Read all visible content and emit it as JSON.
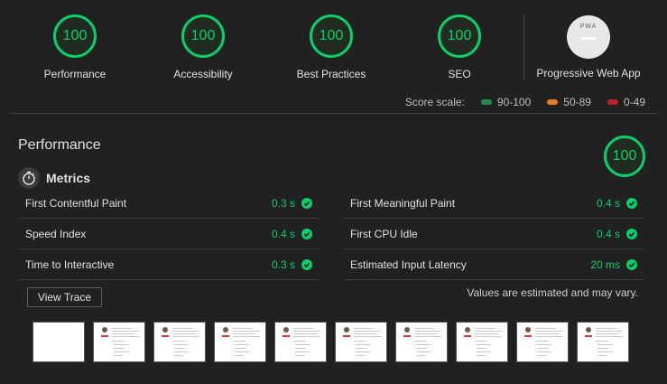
{
  "gauges": [
    {
      "score": "100",
      "label": "Performance"
    },
    {
      "score": "100",
      "label": "Accessibility"
    },
    {
      "score": "100",
      "label": "Best Practices"
    },
    {
      "score": "100",
      "label": "SEO"
    }
  ],
  "pwa": {
    "badge_text": "PWA",
    "label": "Progressive Web App"
  },
  "score_scale": {
    "label": "Score scale:",
    "items": [
      {
        "text": "90-100",
        "color": "#0cce6b"
      },
      {
        "text": "50-89",
        "color": "#ffa400"
      },
      {
        "text": "0-49",
        "color": "#ff4e42"
      }
    ]
  },
  "category": {
    "title": "Performance",
    "score": "100"
  },
  "metrics": {
    "heading": "Metrics",
    "left": [
      {
        "name": "First Contentful Paint",
        "value": "0.3 s"
      },
      {
        "name": "Speed Index",
        "value": "0.4 s"
      },
      {
        "name": "Time to Interactive",
        "value": "0.3 s"
      }
    ],
    "right": [
      {
        "name": "First Meaningful Paint",
        "value": "0.4 s"
      },
      {
        "name": "First CPU Idle",
        "value": "0.4 s"
      },
      {
        "name": "Estimated Input Latency",
        "value": "20 ms"
      }
    ]
  },
  "actions": {
    "view_trace": "View Trace"
  },
  "estimate_note": "Values are estimated and may vary.",
  "colors": {
    "pass": "#0cce6b",
    "background": "#212121"
  }
}
